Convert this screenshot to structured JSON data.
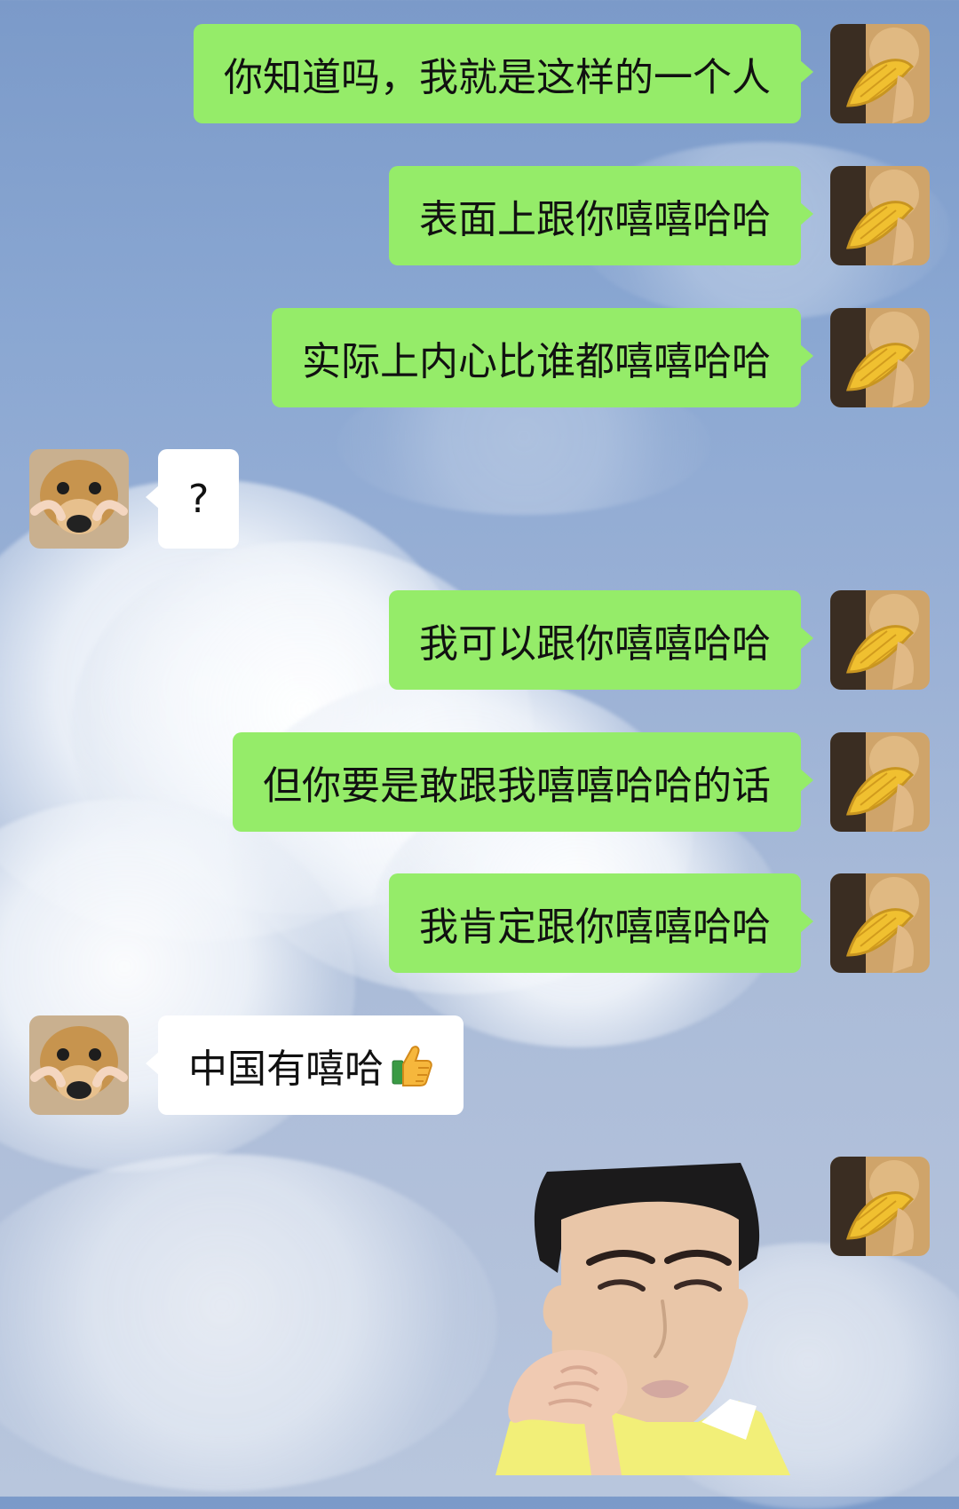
{
  "chat": {
    "messages": [
      {
        "side": "out",
        "text": "你知道吗，我就是这样的一个人"
      },
      {
        "side": "out",
        "text": "表面上跟你嘻嘻哈哈"
      },
      {
        "side": "out",
        "text": "实际上内心比谁都嘻嘻哈哈"
      },
      {
        "side": "in",
        "text": "?"
      },
      {
        "side": "out",
        "text": "我可以跟你嘻嘻哈哈"
      },
      {
        "side": "out",
        "text": "但你要是敢跟我嘻嘻哈哈的话"
      },
      {
        "side": "out",
        "text": "我肯定跟你嘻嘻哈哈"
      },
      {
        "side": "in",
        "text": "中国有嘻哈",
        "emoji": "thumbs-up"
      },
      {
        "side": "out",
        "type": "sticker",
        "sticker": "man-face-sticker"
      }
    ],
    "colors": {
      "outgoing_bubble": "#95ec69",
      "incoming_bubble": "#ffffff",
      "text": "#111111"
    },
    "avatars": {
      "self": "cat-with-bread-avatar",
      "other": "dog-face-avatar"
    }
  }
}
